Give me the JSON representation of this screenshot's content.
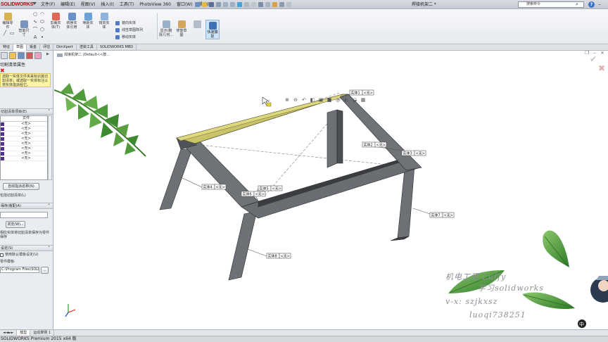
{
  "app": {
    "logo": "SOLIDWORKS",
    "document_title": "焊接机架二 *",
    "edition": "SOLIDWORKS Premium 2015 x64 版"
  },
  "menu": [
    "文件(F)",
    "编辑(E)",
    "视图(V)",
    "插入(I)",
    "工具(T)",
    "PhotoView 360",
    "窗口(W)",
    "帮助(H)"
  ],
  "search": {
    "placeholder": "搜索命令"
  },
  "command_manager": {
    "buttons": [
      {
        "label": "编辑零\n件",
        "icon": "edit-part-icon"
      },
      {
        "label": "智能尺\n寸",
        "icon": "smart-dimension-icon"
      },
      {
        "label": "剪裁实\n体(T)",
        "icon": "trim-entities-icon"
      },
      {
        "label": "转换实\n体引用",
        "icon": "convert-entities-icon"
      },
      {
        "label": "等距实\n体",
        "icon": "offset-entities-icon"
      },
      {
        "label": "镜向实\n体",
        "icon": "mirror-entities-icon"
      },
      {
        "label": "显示/删\n除几何...",
        "icon": "display-relations-icon"
      },
      {
        "label": "修复草\n图",
        "icon": "repair-sketch-icon"
      },
      {
        "label": "快速捕\n捉",
        "icon": "quick-snaps-icon"
      }
    ],
    "small_items": [
      "镜向实体",
      "线性草图阵列",
      "移动实体"
    ]
  },
  "command_tabs": [
    {
      "label": "特征",
      "active": false
    },
    {
      "label": "草图",
      "active": true
    },
    {
      "label": "钣金",
      "active": false
    },
    {
      "label": "评估",
      "active": false
    },
    {
      "label": "DimXpert",
      "active": false
    },
    {
      "label": "渲染工具",
      "active": false
    },
    {
      "label": "SOLIDWORKS MBD",
      "active": false
    }
  ],
  "property_manager": {
    "title": "切割清单属性",
    "message": "选取一实体文件夹来标识其切割清单；或选取一实体标注以将实体指派给它。",
    "cut_list_group": "切割清单项目(E)",
    "cut_table": {
      "header": "文件",
      "rows": [
        "<无>",
        "<无>",
        "<无>",
        "<无>",
        "<无>",
        "<无>",
        "<无>",
        "<无>"
      ]
    },
    "auto_name_button": "自动指派名称(N)",
    "cut_list_check": "包括切割清单(L)",
    "template_group": "保存/装配(A)",
    "browse_button": "浏览(W)...",
    "note": "相应实体将切割清单保存为零件保存",
    "settings_group": "设定(S)",
    "default_template_check": "使用默认模板设定(U)",
    "template_label": "零件模板:",
    "template_path": "C:\\Program Files\\SOLIDWORKS",
    "template_browse": "..."
  },
  "graphics": {
    "tree_flyout": "焊接机架二 (Default<<按...",
    "callout_label": "实体",
    "callout_value": "<无>",
    "callouts": [
      {
        "id": "1",
        "number": "1"
      },
      {
        "id": "2",
        "number": "2"
      },
      {
        "id": "3",
        "number": "3"
      },
      {
        "id": "4",
        "number": "4"
      },
      {
        "id": "5",
        "number": "5"
      },
      {
        "id": "6",
        "number": "6"
      },
      {
        "id": "7",
        "number": "7"
      },
      {
        "id": "8",
        "number": "8"
      }
    ],
    "watermark": [
      "机电工程 Luffy",
      "学习solidworks",
      "v-x: szjkxsz",
      "luoqi738251"
    ]
  },
  "bottom_tabs": [
    {
      "label": "模型",
      "active": true
    },
    {
      "label": "运动算例 1",
      "active": false
    }
  ],
  "colors": {
    "selected_member": "#c9c36a",
    "frame_gray": "#5e6166",
    "frame_dark": "#3a3c40",
    "leaf_green": "#4a9a3a",
    "swatch_purple": "#55308f",
    "message_yellow": "#fff6a3"
  }
}
